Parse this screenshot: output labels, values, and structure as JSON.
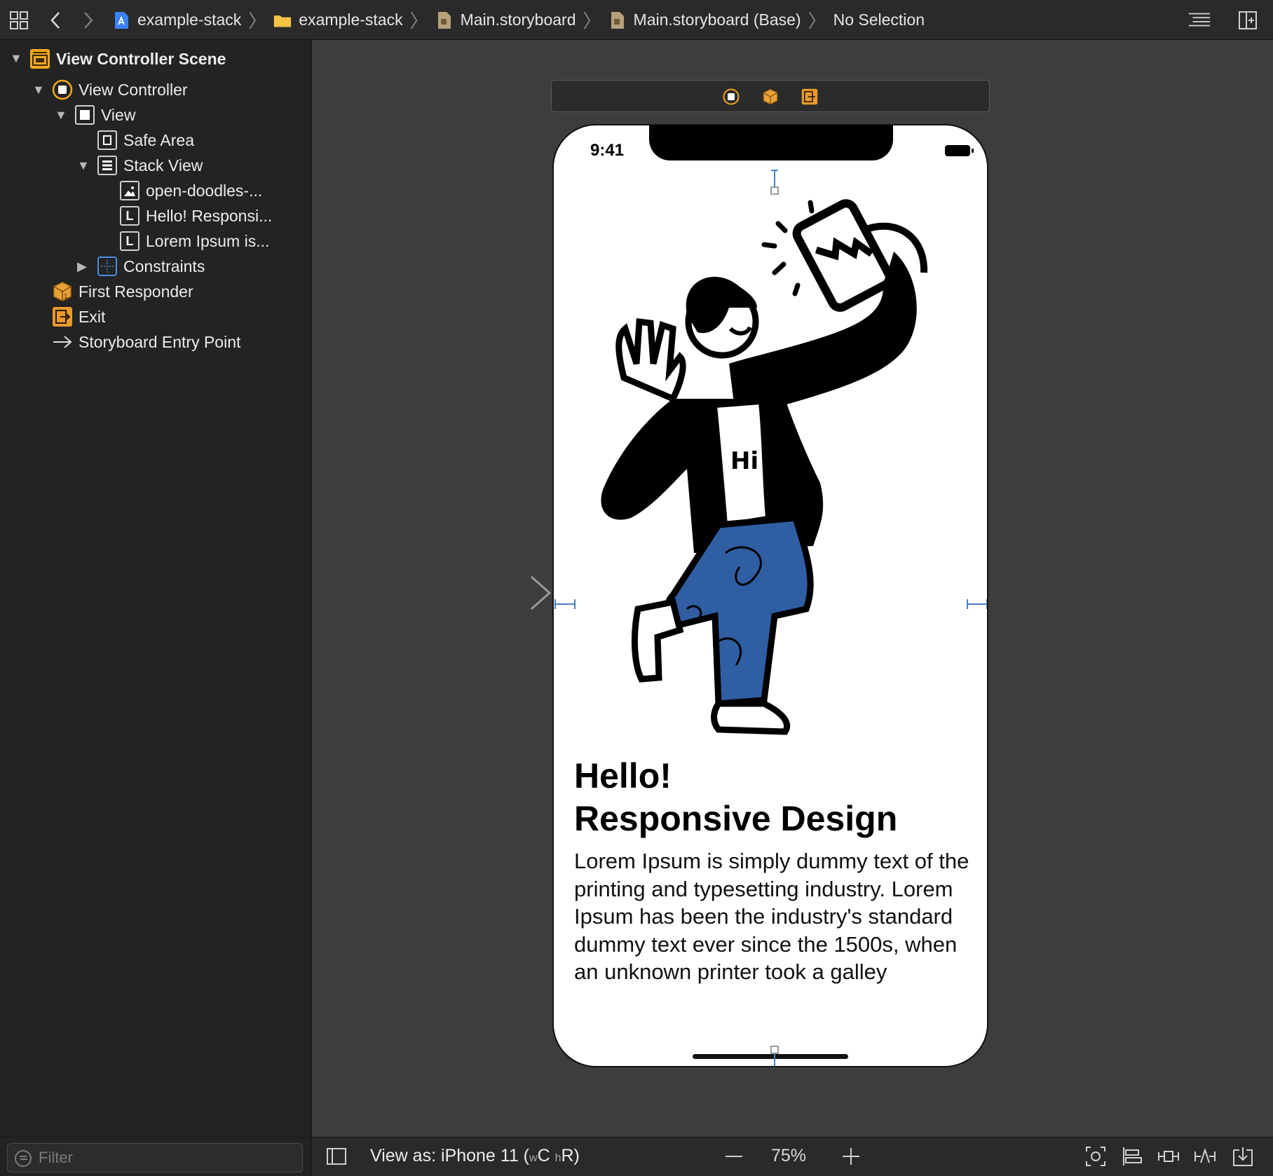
{
  "breadcrumbs": [
    {
      "label": "example-stack",
      "icon": "project-icon"
    },
    {
      "label": "example-stack",
      "icon": "folder-icon"
    },
    {
      "label": "Main.storyboard",
      "icon": "storyboard-file-icon"
    },
    {
      "label": "Main.storyboard (Base)",
      "icon": "storyboard-file-icon"
    },
    {
      "label": "No Selection"
    }
  ],
  "outline": {
    "items": [
      {
        "label": "View Controller Scene",
        "icon": "scene-icon"
      },
      {
        "label": "View Controller",
        "icon": "view-controller-icon"
      },
      {
        "label": "View",
        "icon": "view-icon"
      },
      {
        "label": "Safe Area",
        "icon": "safe-area-icon"
      },
      {
        "label": "Stack View",
        "icon": "stack-view-icon"
      },
      {
        "label": "open-doodles-...",
        "icon": "image-view-icon"
      },
      {
        "label": "Hello! Responsi...",
        "icon": "label-icon",
        "badge": "L"
      },
      {
        "label": "Lorem Ipsum is...",
        "icon": "label-icon",
        "badge": "L"
      },
      {
        "label": "Constraints",
        "icon": "constraints-icon"
      },
      {
        "label": "First Responder",
        "icon": "first-responder-icon"
      },
      {
        "label": "Exit",
        "icon": "exit-icon"
      },
      {
        "label": "Storyboard Entry Point",
        "icon": "arrow-right-icon"
      }
    ],
    "filter_placeholder": "Filter"
  },
  "device": {
    "time": "9:41",
    "headline_line1": "Hello!",
    "headline_line2": "Responsive Design",
    "body": "Lorem Ipsum is simply dummy text of the printing and typesetting industry. Lorem Ipsum has been the industry's standard dummy text ever since the 1500s, when an unknown printer took a galley",
    "shirt_text": "Hi"
  },
  "bottom": {
    "view_as": "View as: iPhone 11 (",
    "w_small": "w",
    "w_big": "C",
    "h_small": "h",
    "h_big": "R",
    "close_paren": ")",
    "zoom": "75%"
  },
  "colors": {
    "accent_orange": "#f0a020",
    "constraint_blue": "#4a7fc1",
    "jeans_blue": "#2f5ea3"
  }
}
